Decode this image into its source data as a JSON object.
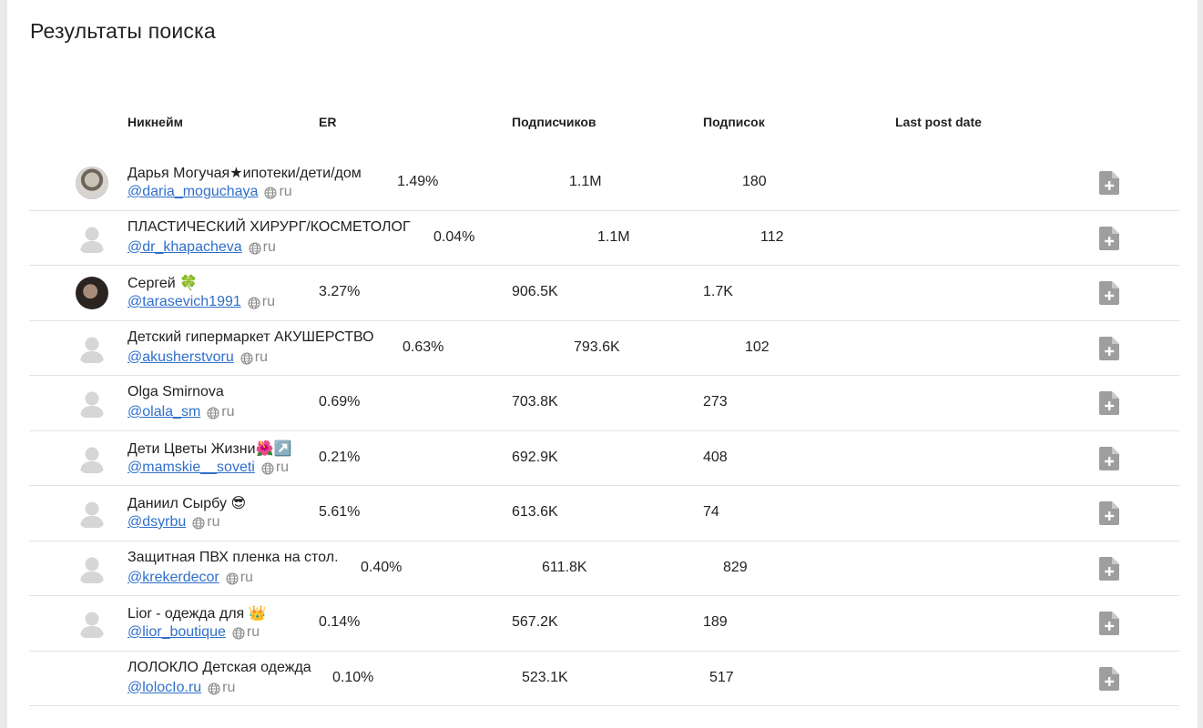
{
  "page": {
    "title": "Результаты поиска"
  },
  "table": {
    "headers": {
      "nickname": "Никнейм",
      "er": "ER",
      "followers": "Подписчиков",
      "following": "Подписок",
      "last_post_date": "Last post date"
    },
    "rows": [
      {
        "name": "Дарья Могучая★ипотеки/дети/дом",
        "handle": "@daria_moguchaya",
        "lang": "ru",
        "er": "1.49%",
        "followers": "1.1M",
        "following": "180",
        "avatar": "photo"
      },
      {
        "name": "ПЛАСТИЧЕСКИЙ ХИРУРГ/КОСМЕТОЛОГ",
        "handle": "@dr_khapacheva",
        "lang": "ru",
        "er": "0.04%",
        "followers": "1.1M",
        "following": "112",
        "avatar": "placeholder"
      },
      {
        "name": "Сергей 🍀",
        "handle": "@tarasevich1991",
        "lang": "ru",
        "er": "3.27%",
        "followers": "906.5K",
        "following": "1.7K",
        "avatar": "photo"
      },
      {
        "name": "Детский гипермаркет АКУШЕРСТВО",
        "handle": "@akusherstvoru",
        "lang": "ru",
        "er": "0.63%",
        "followers": "793.6K",
        "following": "102",
        "avatar": "placeholder"
      },
      {
        "name": "Olga Smirnova",
        "handle": "@olala_sm",
        "lang": "ru",
        "er": "0.69%",
        "followers": "703.8K",
        "following": "273",
        "avatar": "placeholder"
      },
      {
        "name": "Дети Цветы Жизни🌺↗️",
        "handle": "@mamskie__soveti",
        "lang": "ru",
        "er": "0.21%",
        "followers": "692.9K",
        "following": "408",
        "avatar": "placeholder"
      },
      {
        "name": "Даниил Сырбу 😎",
        "handle": "@dsyrbu",
        "lang": "ru",
        "er": "5.61%",
        "followers": "613.6K",
        "following": "74",
        "avatar": "placeholder"
      },
      {
        "name": "Защитная ПВХ пленка на стол.",
        "handle": "@krekerdecor",
        "lang": "ru",
        "er": "0.40%",
        "followers": "611.8K",
        "following": "829",
        "avatar": "placeholder"
      },
      {
        "name": "Lior - одежда для 👑",
        "handle": "@lior_boutique",
        "lang": "ru",
        "er": "0.14%",
        "followers": "567.2K",
        "following": "189",
        "avatar": "placeholder"
      },
      {
        "name": "ЛОЛОКЛО Детская одежда",
        "handle": "@lolocIo.ru",
        "lang": "ru",
        "er": "0.10%",
        "followers": "523.1K",
        "following": "517",
        "avatar": "none"
      }
    ]
  },
  "icons": {
    "globe": "globe-icon",
    "add_report": "file-add-icon",
    "avatar_placeholder": "user-placeholder-icon"
  },
  "colors": {
    "link": "#2f6fc9",
    "icon_gray": "#9e9e9e",
    "divider": "#e2e2e2"
  }
}
